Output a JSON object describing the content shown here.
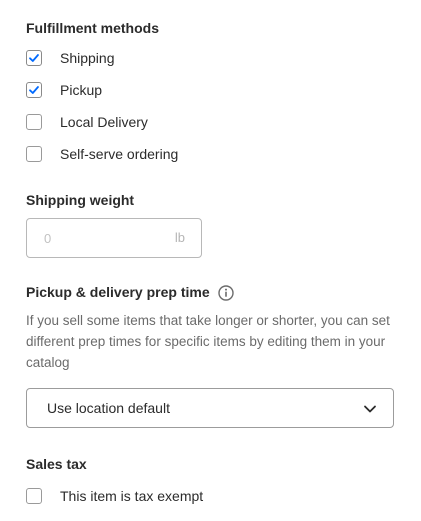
{
  "fulfillment": {
    "title": "Fulfillment methods",
    "options": [
      {
        "label": "Shipping",
        "checked": true
      },
      {
        "label": "Pickup",
        "checked": true
      },
      {
        "label": "Local Delivery",
        "checked": false
      },
      {
        "label": "Self-serve ordering",
        "checked": false
      }
    ]
  },
  "shipping_weight": {
    "title": "Shipping weight",
    "placeholder": "0",
    "value": "",
    "unit": "lb"
  },
  "prep_time": {
    "title": "Pickup & delivery prep time",
    "info_icon": "info-circle-icon",
    "help_text": "If you sell some items that take longer or shorter, you can set different prep times for specific items by editing them in your catalog",
    "selected": "Use location default",
    "dropdown_icon": "chevron-down-icon"
  },
  "sales_tax": {
    "title": "Sales tax",
    "exempt_label": "This item is tax exempt",
    "exempt_checked": false
  },
  "colors": {
    "accent": "#006aff",
    "text": "#2b2b2b",
    "muted_text": "#6b6b6b",
    "border": "#b8b8b8"
  }
}
